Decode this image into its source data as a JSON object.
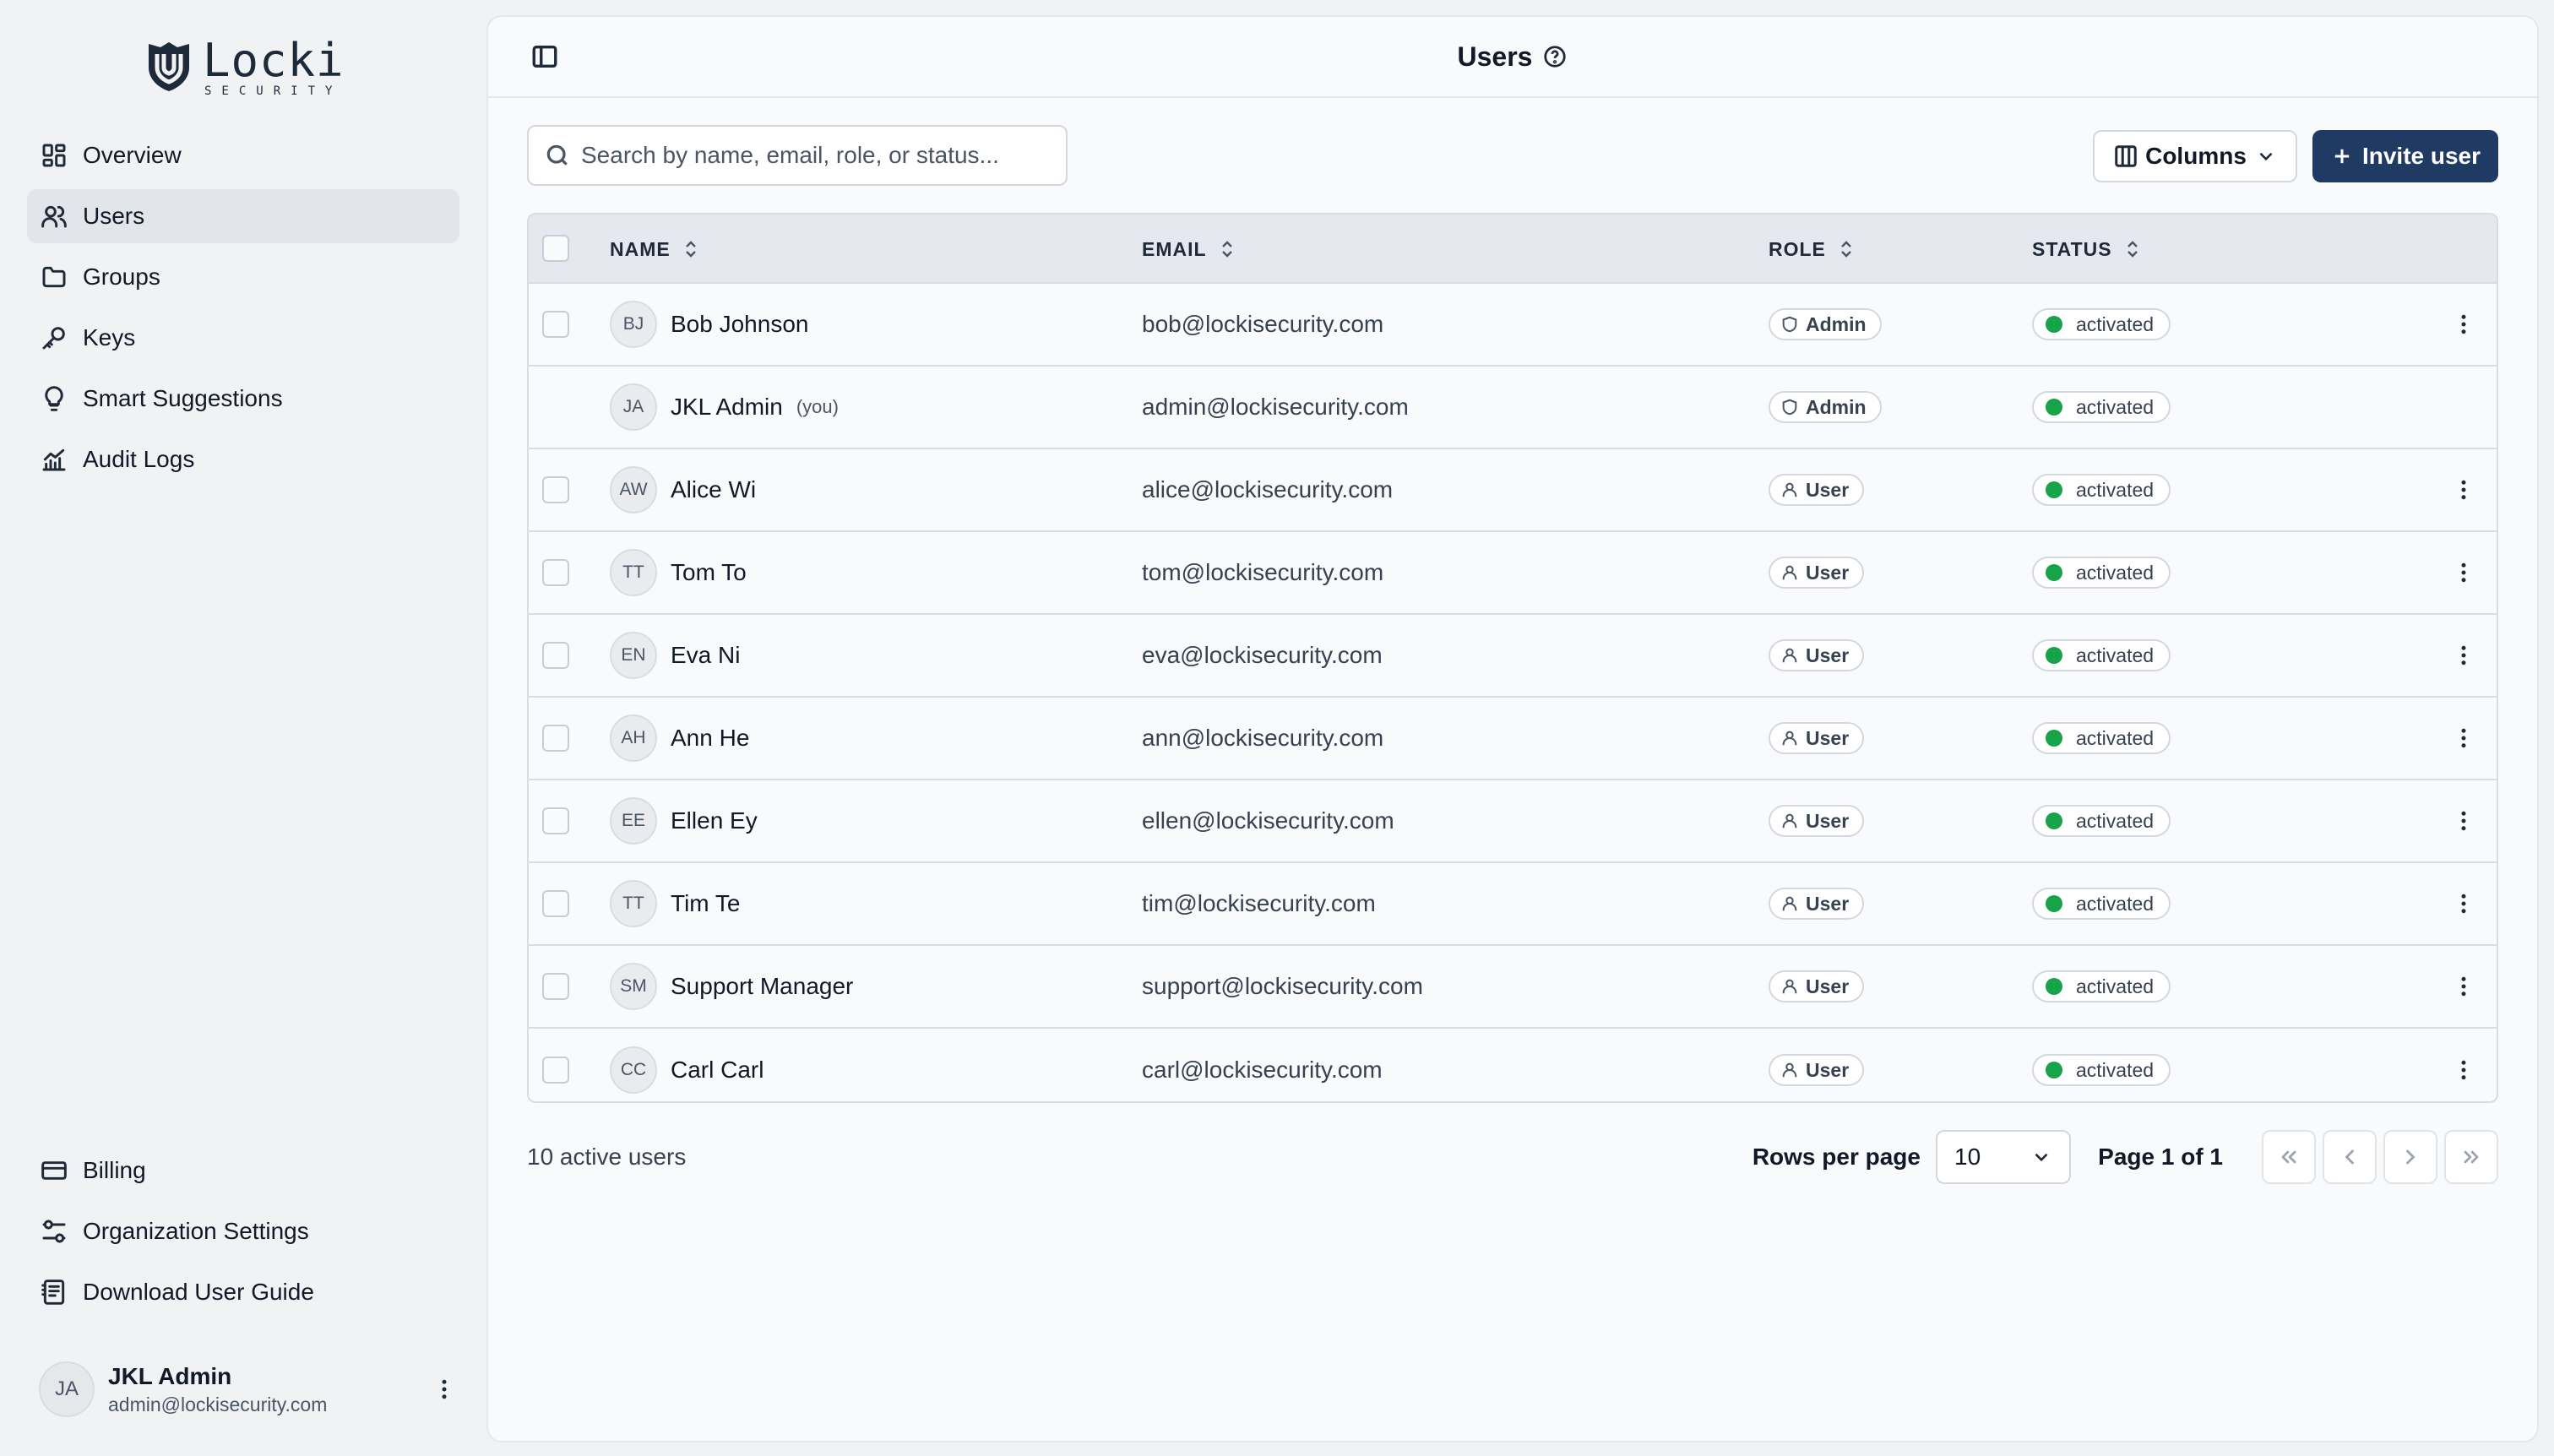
{
  "brand": {
    "name": "Locki",
    "tagline": "SECURITY"
  },
  "sidebar": {
    "items": [
      {
        "label": "Overview",
        "icon": "dashboard-icon"
      },
      {
        "label": "Users",
        "icon": "users-icon",
        "active": true
      },
      {
        "label": "Groups",
        "icon": "folder-icon"
      },
      {
        "label": "Keys",
        "icon": "key-icon"
      },
      {
        "label": "Smart Suggestions",
        "icon": "lightbulb-icon"
      },
      {
        "label": "Audit Logs",
        "icon": "chart-icon"
      }
    ],
    "bottom_items": [
      {
        "label": "Billing",
        "icon": "credit-card-icon"
      },
      {
        "label": "Organization Settings",
        "icon": "settings-sliders-icon"
      },
      {
        "label": "Download User Guide",
        "icon": "document-icon"
      }
    ],
    "current_user": {
      "initials": "JA",
      "name": "JKL Admin",
      "email": "admin@lockisecurity.com"
    }
  },
  "header": {
    "title": "Users"
  },
  "toolbar": {
    "search_placeholder": "Search by name, email, role, or status...",
    "columns_label": "Columns",
    "invite_label": "Invite user"
  },
  "table": {
    "headers": {
      "name": "NAME",
      "email": "EMAIL",
      "role": "ROLE",
      "status": "STATUS"
    },
    "rows": [
      {
        "initials": "BJ",
        "name": "Bob Johnson",
        "you": "",
        "email": "bob@lockisecurity.com",
        "role": "Admin",
        "status": "activated"
      },
      {
        "initials": "JA",
        "name": "JKL Admin",
        "you": "(you)",
        "email": "admin@lockisecurity.com",
        "role": "Admin",
        "status": "activated"
      },
      {
        "initials": "AW",
        "name": "Alice Wi",
        "you": "",
        "email": "alice@lockisecurity.com",
        "role": "User",
        "status": "activated"
      },
      {
        "initials": "TT",
        "name": "Tom To",
        "you": "",
        "email": "tom@lockisecurity.com",
        "role": "User",
        "status": "activated"
      },
      {
        "initials": "EN",
        "name": "Eva Ni",
        "you": "",
        "email": "eva@lockisecurity.com",
        "role": "User",
        "status": "activated"
      },
      {
        "initials": "AH",
        "name": "Ann He",
        "you": "",
        "email": "ann@lockisecurity.com",
        "role": "User",
        "status": "activated"
      },
      {
        "initials": "EE",
        "name": "Ellen Ey",
        "you": "",
        "email": "ellen@lockisecurity.com",
        "role": "User",
        "status": "activated"
      },
      {
        "initials": "TT",
        "name": "Tim Te",
        "you": "",
        "email": "tim@lockisecurity.com",
        "role": "User",
        "status": "activated"
      },
      {
        "initials": "SM",
        "name": "Support Manager",
        "you": "",
        "email": "support@lockisecurity.com",
        "role": "User",
        "status": "activated"
      },
      {
        "initials": "CC",
        "name": "Carl Carl",
        "you": "",
        "email": "carl@lockisecurity.com",
        "role": "User",
        "status": "activated"
      }
    ]
  },
  "footer": {
    "count_text": "10 active users",
    "rows_per_page_label": "Rows per page",
    "rows_per_page_value": "10",
    "page_info": "Page 1 of 1"
  },
  "colors": {
    "primary": "#1f3b63",
    "status_active": "#16a34a",
    "active_nav": "#e2e5ea"
  }
}
